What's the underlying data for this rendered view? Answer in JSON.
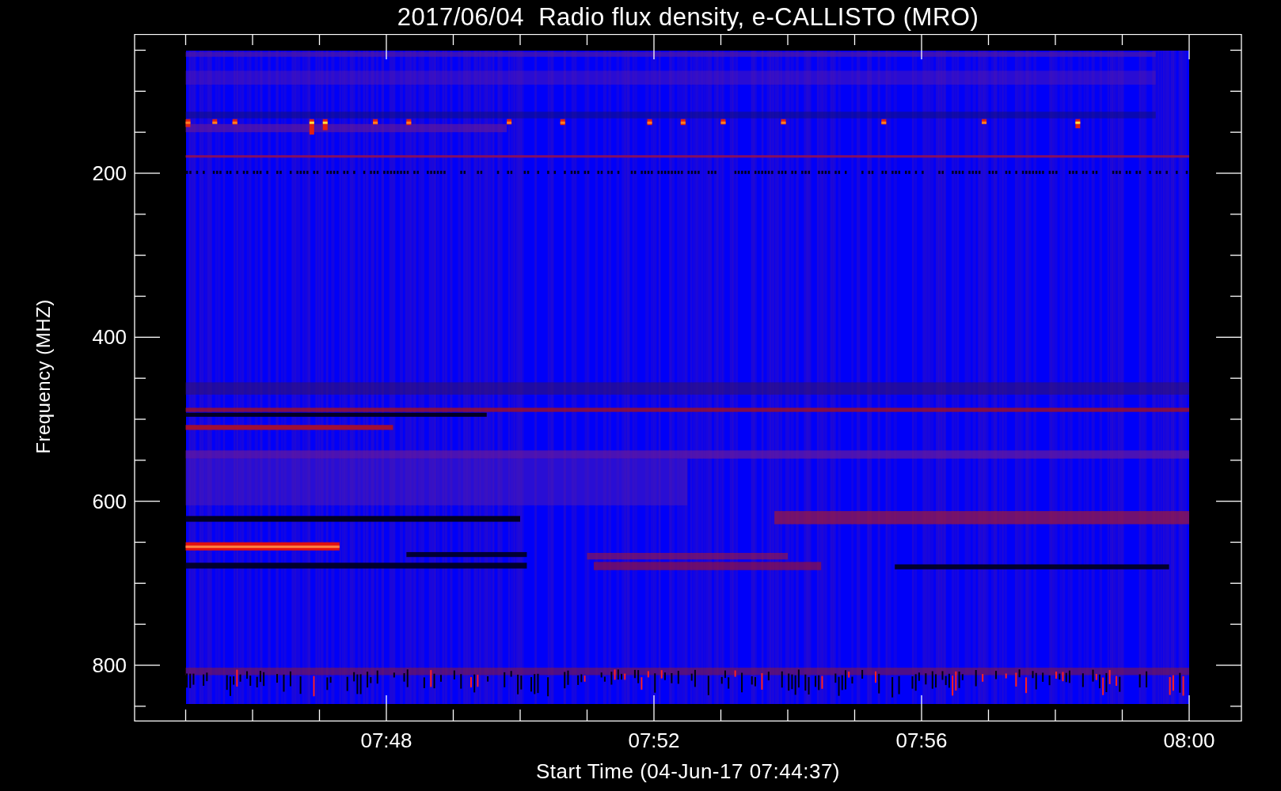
{
  "title": "2017/06/04  Radio flux density, e-CALLISTO (MRO)",
  "y_axis": {
    "label": "Frequency (MHZ)",
    "ticks": [
      "200",
      "400",
      "600",
      "800"
    ]
  },
  "x_axis": {
    "label": "Start Time (04-Jun-17 07:44:37)",
    "ticks": [
      "07:48",
      "07:52",
      "07:56",
      "08:00"
    ]
  }
}
